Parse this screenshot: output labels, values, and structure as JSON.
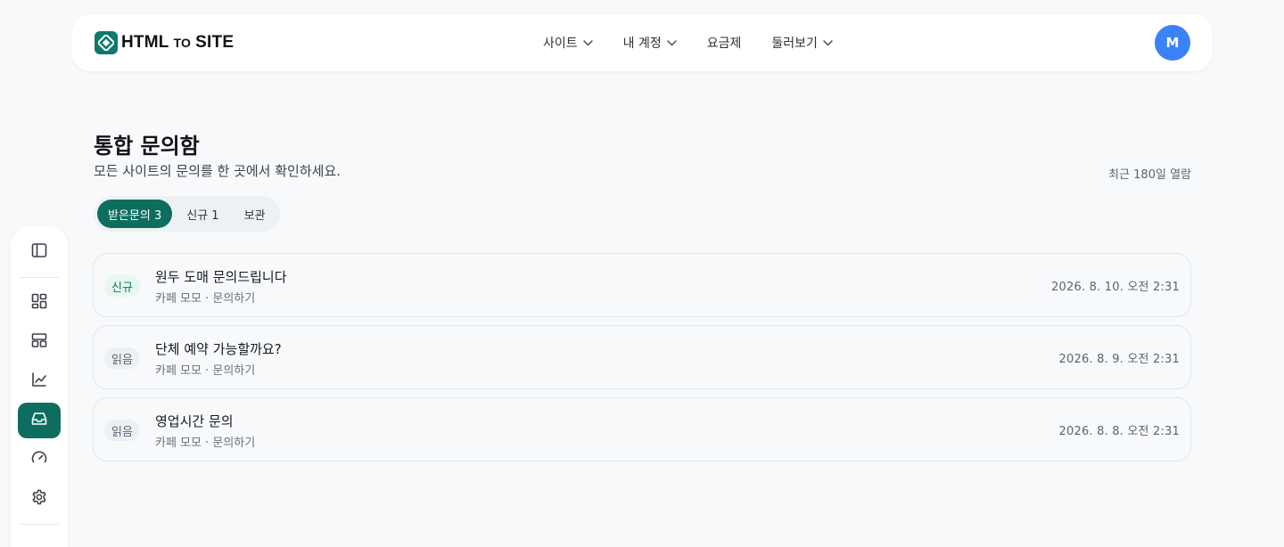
{
  "header": {
    "logo_main": "HTML",
    "logo_small": "TO",
    "logo_end": "SITE",
    "nav": [
      {
        "label": "사이트",
        "has_dropdown": true
      },
      {
        "label": "내 계정",
        "has_dropdown": true
      },
      {
        "label": "요금제",
        "has_dropdown": false
      },
      {
        "label": "둘러보기",
        "has_dropdown": true
      }
    ],
    "avatar_initial": "M",
    "avatar_color": "#3b82f6"
  },
  "sidebar": {
    "items": [
      {
        "name": "sidebar-toggle",
        "icon": "panel-left-icon",
        "active": false
      },
      {
        "name": "sidebar-item-dashboard",
        "icon": "grid-icon",
        "active": false
      },
      {
        "name": "sidebar-item-layout",
        "icon": "layout-icon",
        "active": false
      },
      {
        "name": "sidebar-item-analytics",
        "icon": "chart-line-icon",
        "active": false
      },
      {
        "name": "sidebar-item-inbox",
        "icon": "inbox-icon",
        "active": true
      },
      {
        "name": "sidebar-item-performance",
        "icon": "gauge-icon",
        "active": false
      },
      {
        "name": "sidebar-item-settings",
        "icon": "gear-icon",
        "active": false
      }
    ]
  },
  "main": {
    "title": "통합 문의함",
    "subtitle": "모든 사이트의 문의를 한 곳에서 확인하세요.",
    "retention": "최근 180일 열람",
    "tabs": [
      {
        "label": "받은문의 3",
        "active": true
      },
      {
        "label": "신규 1",
        "active": false
      },
      {
        "label": "보관",
        "active": false
      }
    ],
    "messages": [
      {
        "status": "신규",
        "status_type": "new",
        "title": "원두 도매 문의드립니다",
        "meta": "카페 모모 · 문의하기",
        "date": "2026. 8. 10. 오전 2:31"
      },
      {
        "status": "읽음",
        "status_type": "read",
        "title": "단체 예약 가능할까요?",
        "meta": "카페 모모 · 문의하기",
        "date": "2026. 8. 9. 오전 2:31"
      },
      {
        "status": "읽음",
        "status_type": "read",
        "title": "영업시간 문의",
        "meta": "카페 모모 · 문의하기",
        "date": "2026. 8. 8. 오전 2:31"
      }
    ]
  },
  "colors": {
    "accent": "#0d6e60",
    "background": "#f7f9fb",
    "new_badge_text": "#0d7a55"
  }
}
